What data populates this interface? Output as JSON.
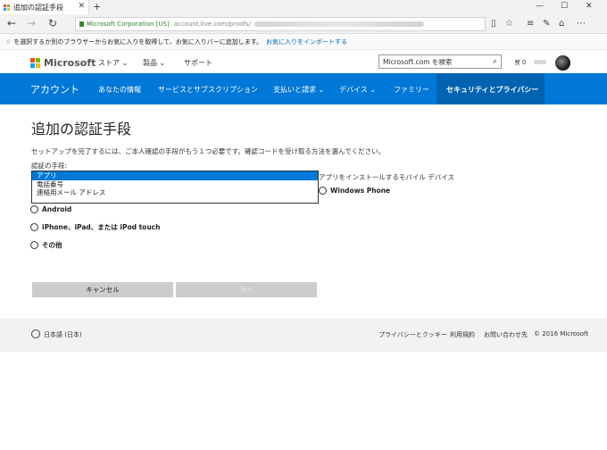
{
  "browser": {
    "tab_title": "追加の認証手段",
    "tab_close": "✕",
    "new_tab": "+",
    "window_controls": [
      "—",
      "☐",
      "✕"
    ],
    "address": {
      "corp": "Microsoft Corporation [US]",
      "url_prefix": "account.live.com/proofs/"
    },
    "favorites_bar": {
      "text": "を選択するか別のブラウザーからお気に入りを取得して、お気に入りバーに追加します。",
      "link": "お気に入りをインポートする"
    }
  },
  "ms_header": {
    "logo_text": "Microsoft",
    "nav": [
      "ストア ⌄",
      "製品 ⌄",
      "サポート"
    ],
    "search_placeholder": "Microsoft.com を検索",
    "cart_count": "0"
  },
  "account_nav": {
    "account_label": "アカウント",
    "items": [
      "あなたの情報",
      "サービスとサブスクリプション",
      "支払いと請求 ⌄",
      "デバイス ⌄",
      "ファミリー",
      "セキュリティとプライバシー"
    ]
  },
  "main": {
    "title": "追加の認証手段",
    "description": "セットアップを完了するには、ご本人確認の手段がもう１つ必要です。確認コードを受け取る方法を選んでください。",
    "method_label": "認証の手段:",
    "dropdown_options": [
      "アプリ",
      "電話番号",
      "連絡用メール アドレス"
    ],
    "device_label": "アプリをインストールするモバイル デバイス",
    "radios": [
      "Windows Phone",
      "Android",
      "iPhone、iPad、または iPod touch",
      "その他"
    ],
    "cancel_label": "キャンセル",
    "next_label": "次へ"
  },
  "footer": {
    "language": "日本語 (日本)",
    "links": [
      "プライバシーとクッキー",
      "利用規約",
      "お問い合わせ先",
      "© 2016 Microsoft"
    ]
  }
}
